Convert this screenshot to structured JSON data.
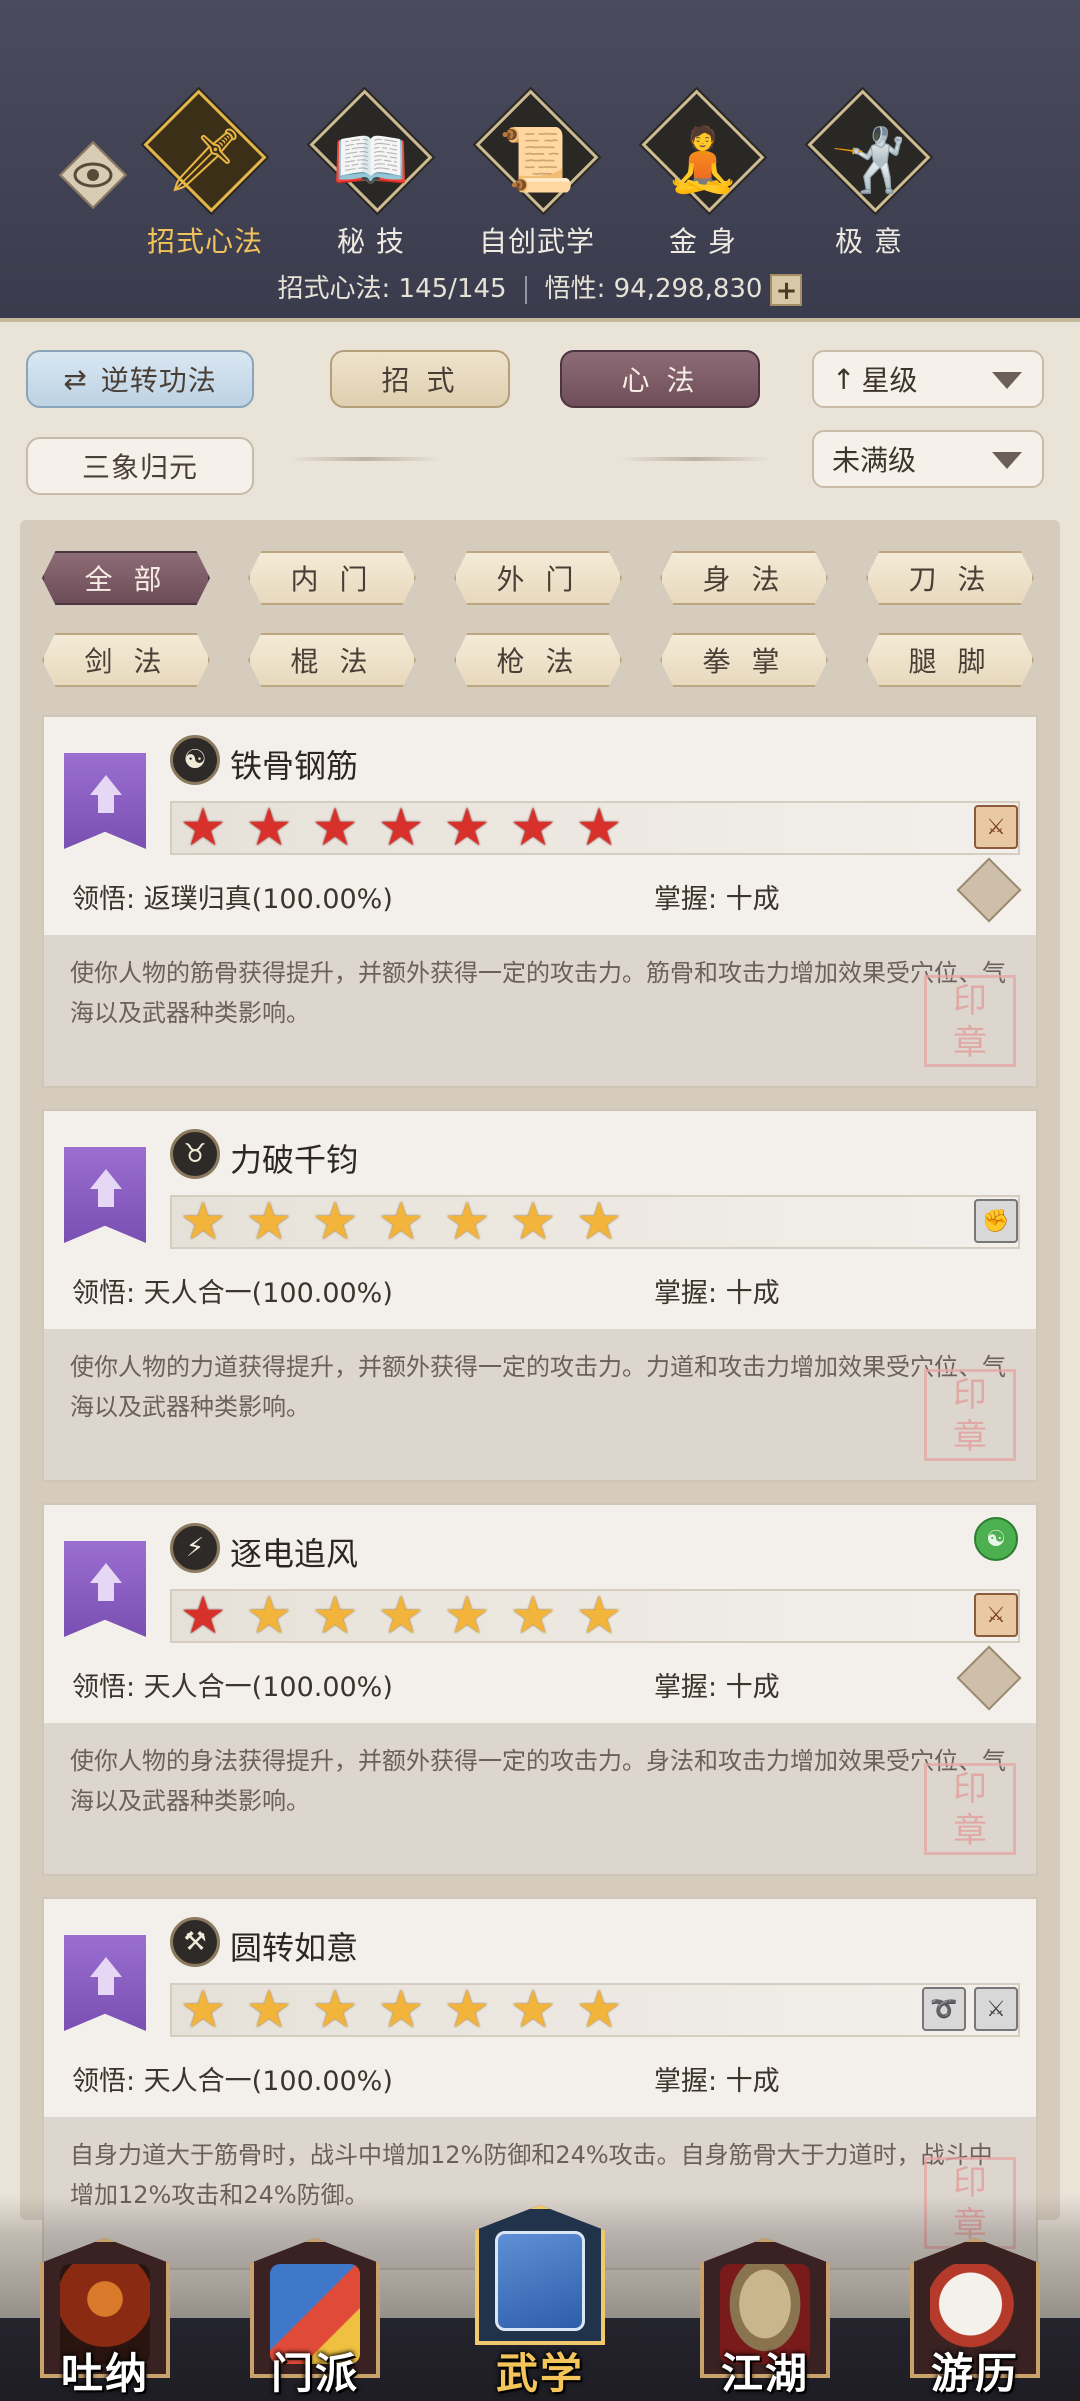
{
  "top_tabs": [
    {
      "label": "招式心法",
      "icon": "sword-icon",
      "glyph": "🗡"
    },
    {
      "label": "秘 技",
      "icon": "book-icon",
      "glyph": "📖"
    },
    {
      "label": "自创武学",
      "icon": "scroll-icon",
      "glyph": "📜"
    },
    {
      "label": "金 身",
      "icon": "meditation-icon",
      "glyph": "🧘"
    },
    {
      "label": "极 意",
      "icon": "martial-pose-icon",
      "glyph": "🤺"
    }
  ],
  "stats": {
    "techniques": "招式心法: 145/145",
    "comprehension": "悟性: 94,298,830"
  },
  "controls": {
    "reverse_btn": "逆转功法",
    "moves_btn": "招 式",
    "mind_btn": "心 法",
    "star_sort": "星级",
    "sanxiang_btn": "三象归元",
    "filter_sel": "未满级"
  },
  "categories": [
    "全 部",
    "内 门",
    "外 门",
    "身 法",
    "刀 法",
    "剑 法",
    "棍 法",
    "枪 法",
    "拳 掌",
    "腿 脚"
  ],
  "skills": [
    {
      "name": "铁骨钢筋",
      "icon": "yin-yang-icon",
      "glyph": "☯",
      "red_stars": 7,
      "insight": "领悟: 返璞归真(100.00%)",
      "mastery": "掌握: 十成",
      "desc": "使你人物的筋骨获得提升，并额外获得一定的攻击力。筋骨和攻击力增加效果受穴位、气海以及武器种类影响。"
    },
    {
      "name": "力破千钧",
      "icon": "strength-icon",
      "glyph": "♉",
      "red_stars": 0,
      "insight": "领悟: 天人合一(100.00%)",
      "mastery": "掌握: 十成",
      "desc": "使你人物的力道获得提升，并额外获得一定的攻击力。力道和攻击力增加效果受穴位、气海以及武器种类影响。"
    },
    {
      "name": "逐电追风",
      "icon": "boot-icon",
      "glyph": "⚡",
      "red_stars": 1,
      "insight": "领悟: 天人合一(100.00%)",
      "mastery": "掌握: 十成",
      "desc": "使你人物的身法获得提升，并额外获得一定的攻击力。身法和攻击力增加效果受穴位、气海以及武器种类影响。"
    },
    {
      "name": "圆转如意",
      "icon": "staff-icon",
      "glyph": "⚒",
      "red_stars": 0,
      "insight": "领悟: 天人合一(100.00%)",
      "mastery": "掌握: 十成",
      "desc": "自身力道大于筋骨时，战斗中增加12%防御和24%攻击。自身筋骨大于力道时，战斗中增加12%攻击和24%防御。"
    }
  ],
  "bottom_nav": [
    {
      "label": "吐纳",
      "icon": "monk-icon"
    },
    {
      "label": "门派",
      "icon": "banner-icon"
    },
    {
      "label": "武学",
      "icon": "manual-icon"
    },
    {
      "label": "江湖",
      "icon": "straw-hat-icon"
    },
    {
      "label": "游历",
      "icon": "horse-icon"
    }
  ],
  "colors": {
    "accent_gold": "#e9b545",
    "active_purple": "#7a5664",
    "star_gold": "#f2b43a",
    "star_red": "#d8302a"
  }
}
